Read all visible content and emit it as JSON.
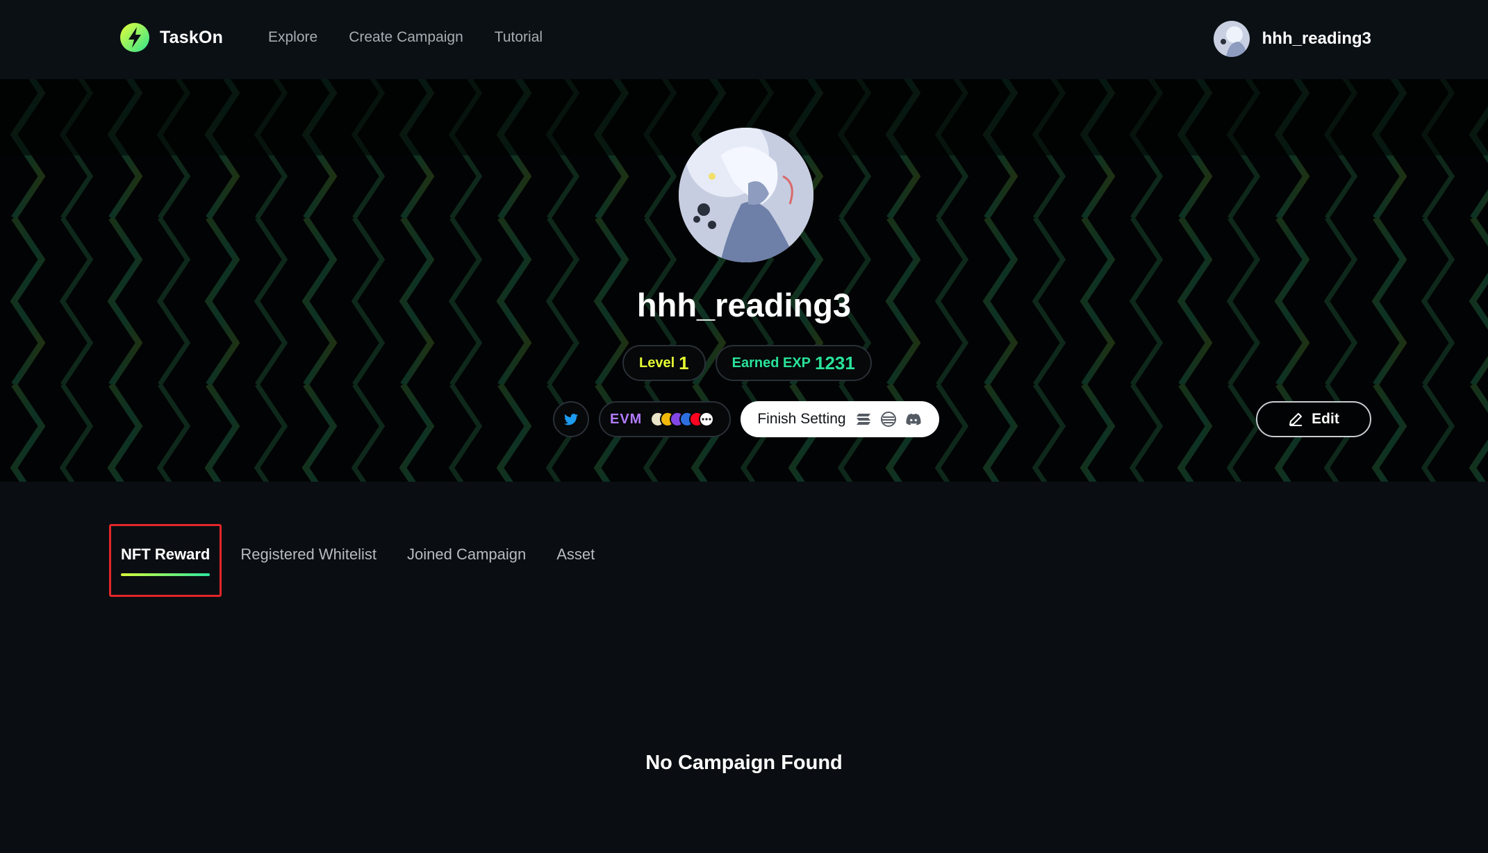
{
  "app": {
    "name": "TaskOn"
  },
  "nav": {
    "items": [
      "Explore",
      "Create Campaign",
      "Tutorial"
    ]
  },
  "user_menu": {
    "username": "hhh_reading3"
  },
  "profile": {
    "username": "hhh_reading3",
    "level_label": "Level",
    "level_value": "1",
    "exp_label": "Earned EXP",
    "exp_value": "1231",
    "wallet_label": "EVM",
    "finish_label": "Finish Setting",
    "edit_label": "Edit"
  },
  "tabs": [
    "NFT Reward",
    "Registered Whitelist",
    "Joined Campaign",
    "Asset"
  ],
  "active_tab": "NFT Reward",
  "empty_state": {
    "message": "No Campaign Found"
  },
  "colors": {
    "level": "#e6ff33",
    "exp": "#29e29a",
    "evm": "#b27cff",
    "highlight_box": "#e4262a",
    "twitter": "#1d9bf0"
  }
}
